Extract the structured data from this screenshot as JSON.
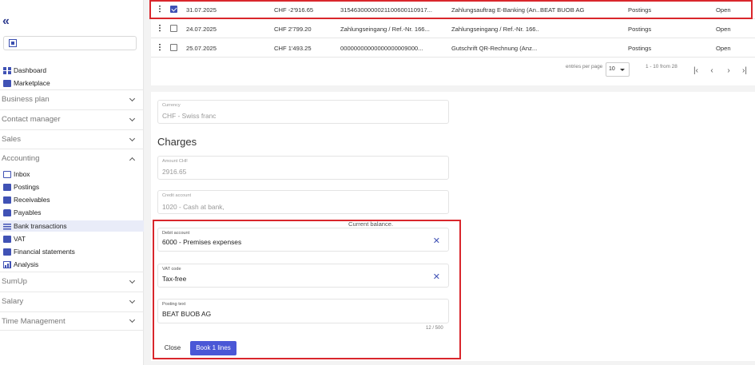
{
  "sidebar": {
    "collapse_icon": "double-chevron-left-icon",
    "nav_top": [
      {
        "label": "Dashboard",
        "icon": "dashboard-grid-icon"
      },
      {
        "label": "Marketplace",
        "icon": "store-icon"
      }
    ],
    "sections": [
      {
        "label": "Business plan",
        "expanded": false
      },
      {
        "label": "Contact manager",
        "expanded": false
      },
      {
        "label": "Sales",
        "expanded": false
      },
      {
        "label": "Accounting",
        "expanded": true
      }
    ],
    "accounting_items": [
      {
        "label": "Inbox",
        "icon": "inbox-icon"
      },
      {
        "label": "Postings",
        "icon": "book-icon"
      },
      {
        "label": "Receivables",
        "icon": "receivables-icon"
      },
      {
        "label": "Payables",
        "icon": "payables-icon"
      },
      {
        "label": "Bank transactions",
        "icon": "bank-lines-icon",
        "active": true
      },
      {
        "label": "VAT",
        "icon": "vat-icon"
      },
      {
        "label": "Financial statements",
        "icon": "financial-statements-icon"
      },
      {
        "label": "Analysis",
        "icon": "analysis-chart-icon"
      }
    ],
    "sections_bottom": [
      {
        "label": "SumUp"
      },
      {
        "label": "Salary"
      },
      {
        "label": "Time Management"
      }
    ]
  },
  "table": {
    "rows": [
      {
        "date": "31.07.2025",
        "amount": "CHF -2'916.65",
        "reference": "31546300000021100600110917...",
        "text": "Zahlungsauftrag E-Banking (An...",
        "name": "BEAT BUOB AG",
        "type": "Postings",
        "status": "Open",
        "checked": true
      },
      {
        "date": "24.07.2025",
        "amount": "CHF 2'799.20",
        "reference": "Zahlungseingang / Ref.-Nr. 166...",
        "text": "Zahlungseingang / Ref.-Nr. 166...",
        "name": "",
        "type": "Postings",
        "status": "Open",
        "checked": false
      },
      {
        "date": "25.07.2025",
        "amount": "CHF 1'493.25",
        "reference": "00000000000000000009000...",
        "text": "Gutschrift QR-Rechnung (Anz...",
        "name": "",
        "type": "Postings",
        "status": "Open",
        "checked": false
      }
    ]
  },
  "pagination": {
    "entries_label": "entries per page",
    "per_page": "10",
    "range": "1 - 10 from 28"
  },
  "form": {
    "currency_label": "Currency",
    "currency_value": "CHF - Swiss franc",
    "heading": "Charges",
    "amount_label": "Amount CHF",
    "amount_value": "2916.65",
    "credit_label": "Credit account",
    "credit_value": "1020 - Cash at bank,",
    "balance_note": "Current balance.",
    "debit_label": "Debit account",
    "debit_value": "6000 - Premises expenses",
    "vat_label": "VAT code",
    "vat_value": "Tax-free",
    "posting_label": "Posting text",
    "posting_value": "BEAT BUOB AG",
    "counter": "12 / 500",
    "close_label": "Close",
    "book_label": "Book 1 lines"
  }
}
